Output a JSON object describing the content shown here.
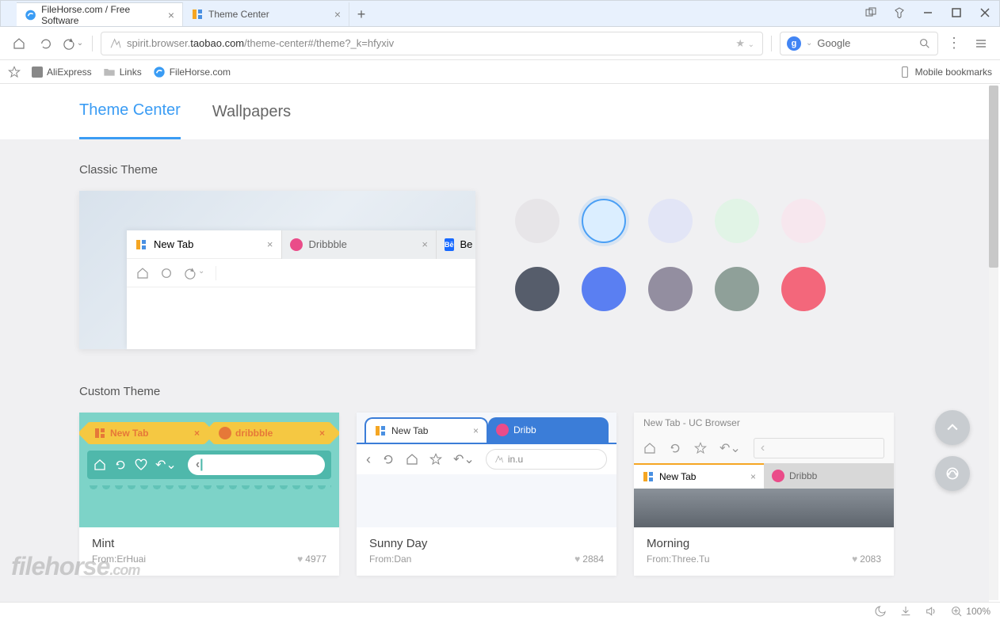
{
  "tabs": [
    {
      "title": "FileHorse.com / Free Software",
      "icon": "filehorse"
    },
    {
      "title": "Theme Center",
      "icon": "uc"
    }
  ],
  "toolbar": {
    "url_prefix": "spirit.browser.",
    "url_domain": "taobao.com",
    "url_path": "/theme-center#/theme?_k=hfyxiv",
    "search_provider": "Google"
  },
  "bookmarks": {
    "items": [
      "AliExpress",
      "Links",
      "FileHorse.com"
    ],
    "mobile": "Mobile bookmarks"
  },
  "nav": {
    "tab1": "Theme Center",
    "tab2": "Wallpapers"
  },
  "sections": {
    "classic": "Classic Theme",
    "custom": "Custom Theme"
  },
  "preview": {
    "tabs": [
      {
        "label": "New Tab",
        "icon": "uc"
      },
      {
        "label": "Dribbble",
        "icon": "dribbble"
      },
      {
        "label": "Be",
        "icon": "behance"
      }
    ]
  },
  "colors": {
    "row1": [
      "#e7e5e8",
      "#dbeeff",
      "#e2e5f6",
      "#e1f4e6",
      "#f7e7ee"
    ],
    "row2": [
      "#565d6b",
      "#5a7ff2",
      "#938ea0",
      "#8fa099",
      "#f3677b"
    ],
    "selected_index": 1
  },
  "themes": [
    {
      "name": "Mint",
      "from_label": "From:",
      "author": "ErHuai",
      "likes": "4977",
      "mock": {
        "tab1": "New Tab",
        "tab2": "dribbble",
        "cursor": "|"
      }
    },
    {
      "name": "Sunny Day",
      "from_label": "From:",
      "author": "Dan",
      "likes": "2884",
      "mock": {
        "tab1": "New Tab",
        "tab2": "Dribb",
        "url": "in.u"
      }
    },
    {
      "name": "Morning",
      "from_label": "From:",
      "author": "Three.Tu",
      "likes": "2083",
      "mock": {
        "title": "New Tab - UC Browser",
        "tab1": "New Tab",
        "tab2": "Dribbb"
      }
    }
  ],
  "status": {
    "zoom": "100%"
  },
  "watermark": {
    "text": "filehorse",
    "suffix": ".com"
  }
}
